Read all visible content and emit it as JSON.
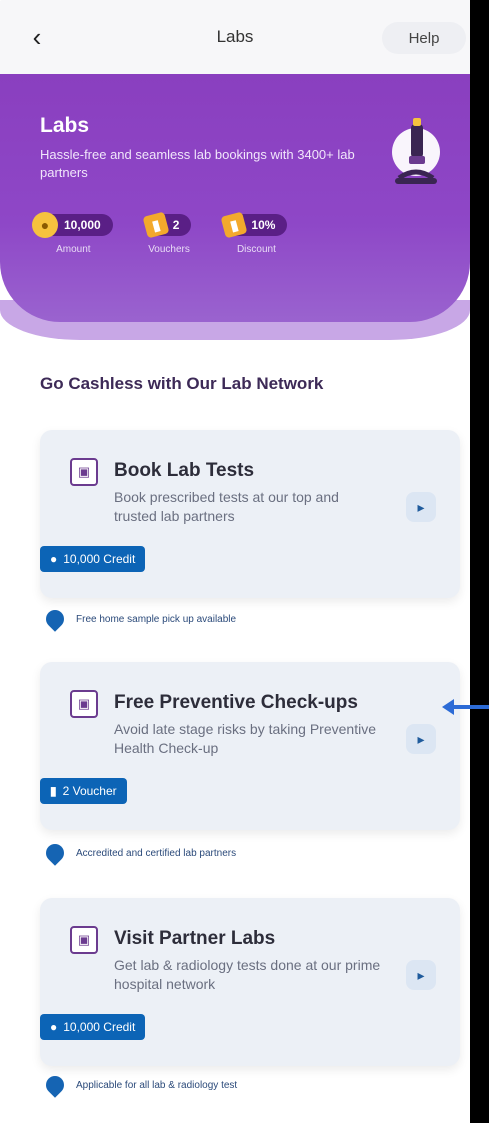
{
  "header": {
    "back_symbol": "‹",
    "title": "Labs",
    "help_label": "Help"
  },
  "hero": {
    "title": "Labs",
    "subtitle": "Hassle-free and seamless lab bookings with 3400+ lab partners",
    "stats": [
      {
        "value": "10,000",
        "label": "Amount",
        "icon": "coin-icon"
      },
      {
        "value": "2",
        "label": "Vouchers",
        "icon": "ticket-icon"
      },
      {
        "value": "10%",
        "label": "Discount",
        "icon": "ticket-icon"
      }
    ]
  },
  "section": {
    "title": "Go Cashless with Our Lab Network"
  },
  "cards": [
    {
      "title": "Book Lab Tests",
      "description": "Book prescribed tests at our top and trusted lab partners",
      "badge": "10,000 Credit",
      "badge_icon": "coin-icon",
      "note": "Free home sample pick up available"
    },
    {
      "title": "Free Preventive Check-ups",
      "description": "Avoid late stage risks by taking Preventive Health Check-up",
      "badge": "2 Voucher",
      "badge_icon": "ticket-icon",
      "note": "Accredited and certified lab partners"
    },
    {
      "title": "Visit Partner Labs",
      "description": "Get lab & radiology tests done at our prime hospital network",
      "badge": "10,000 Credit",
      "badge_icon": "coin-icon",
      "note": "Applicable for all lab & radiology test"
    }
  ],
  "colors": {
    "hero": "#8a3fbf",
    "badge": "#0c64b6",
    "annotation_arrow": "#2c6bd6"
  }
}
